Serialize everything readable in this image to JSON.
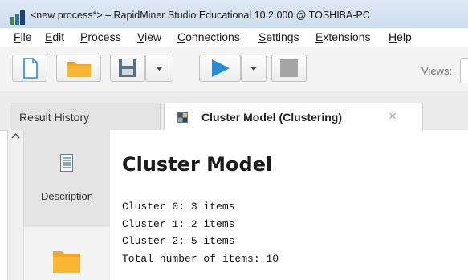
{
  "window": {
    "title": "<new process*> – RapidMiner Studio Educational 10.2.000 @ TOSHIBA-PC"
  },
  "menu": {
    "items": [
      "File",
      "Edit",
      "Process",
      "View",
      "Connections",
      "Settings",
      "Extensions",
      "Help"
    ]
  },
  "toolbar": {
    "buttons": [
      "new-document-icon",
      "open-folder-icon",
      "save-icon",
      "dropdown-arrow-icon",
      "run-play-icon",
      "dropdown-arrow-icon",
      "stop-icon"
    ],
    "views_label": "Views:"
  },
  "tabs": [
    {
      "label": "Result History",
      "active": false
    },
    {
      "label": "Cluster Model (Clustering)",
      "active": true,
      "icon": "cluster-model-icon",
      "close": "×"
    }
  ],
  "sidebar": {
    "items": [
      {
        "label": "Description",
        "icon": "description-document-icon"
      },
      {
        "label": "",
        "icon": "folder-icon"
      }
    ]
  },
  "content": {
    "title": "Cluster Model",
    "lines": [
      "Cluster 0: 3 items",
      "Cluster 1: 2 items",
      "Cluster 2: 5 items",
      "Total number of items: 10"
    ]
  },
  "colors": {
    "accent_blue": "#2a8ad4",
    "folder_orange": "#f5a623",
    "titlebar": "#d6e3f2"
  }
}
